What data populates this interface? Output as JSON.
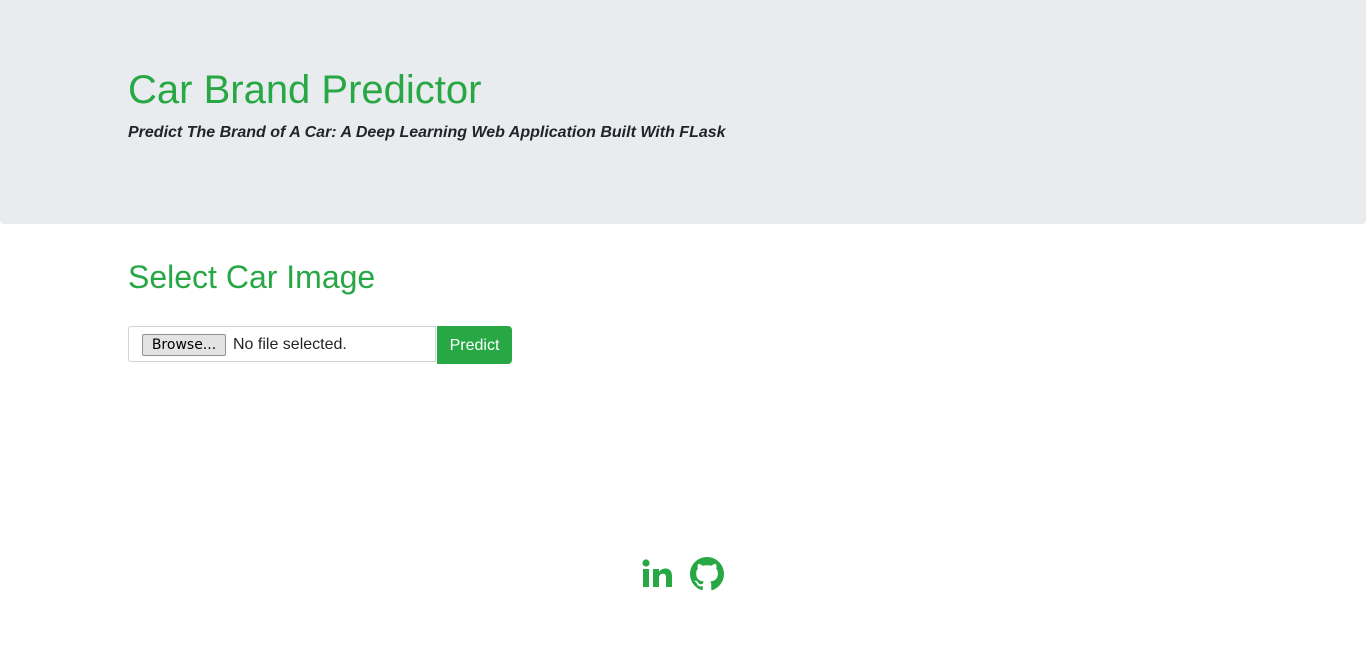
{
  "header": {
    "title": "Car Brand Predictor",
    "subtitle": "Predict The Brand of A Car: A Deep Learning Web Application Built With FLask"
  },
  "upload": {
    "section_title": "Select Car Image",
    "browse_label": "Browse...",
    "file_status": "No file selected.",
    "predict_label": "Predict"
  },
  "footer": {
    "icons": [
      "linkedin-icon",
      "github-icon"
    ]
  },
  "colors": {
    "accent": "#28a745",
    "jumbotron_bg": "#e9ecef",
    "text": "#212529"
  }
}
